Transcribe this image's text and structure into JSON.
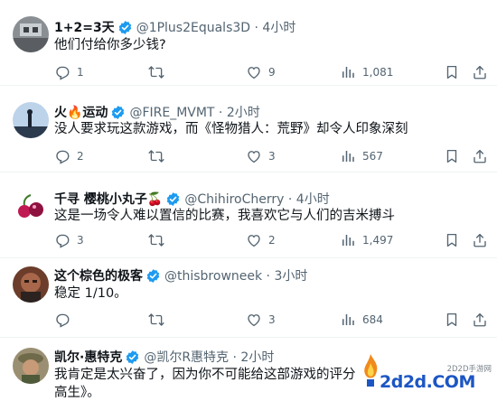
{
  "tweets": [
    {
      "name": "1+2=3天",
      "handle": "@1Plus2Equals3D · 4小时",
      "text": "他们付给你多少钱?",
      "replies": "1",
      "retweets": "",
      "likes": "9",
      "views": "1,081"
    },
    {
      "name": "火🔥运动",
      "handle": "@FIRE_MVMT · 2小时",
      "text": "没人要求玩这款游戏，而《怪物猎人：荒野》却令人印象深刻",
      "replies": "2",
      "retweets": "",
      "likes": "3",
      "views": "567"
    },
    {
      "name": "千寻 樱桃小丸子🍒",
      "handle": "@ChihiroCherry · 4小时",
      "text": "这是一场令人难以置信的比赛，我喜欢它与人们的吉米搏斗",
      "replies": "3",
      "retweets": "",
      "likes": "2",
      "views": "1,497"
    },
    {
      "name": "这个棕色的极客",
      "handle": "@thisbrowneek · 3小时",
      "text": "稳定 1/10。",
      "replies": "",
      "retweets": "",
      "likes": "3",
      "views": "684"
    },
    {
      "name": "凯尔·惠特克",
      "handle": "@凯尔R惠特克 · 2小时",
      "text": "我肯定是太兴奋了，因为你不可能给这部游戏的评分高生》。",
      "replies": "",
      "retweets": "",
      "likes": "",
      "views": ""
    }
  ],
  "watermark": {
    "small": "2D2D手游网",
    "big": "2d2d.COM"
  },
  "colors": {
    "text": "#0f1419",
    "secondary": "#536471",
    "verified": "#1d9bf0",
    "divider": "#eff3f4"
  },
  "icons": [
    "reply-icon",
    "retweet-icon",
    "like-icon",
    "views-icon",
    "bookmark-icon",
    "share-icon",
    "verified-badge-icon"
  ]
}
